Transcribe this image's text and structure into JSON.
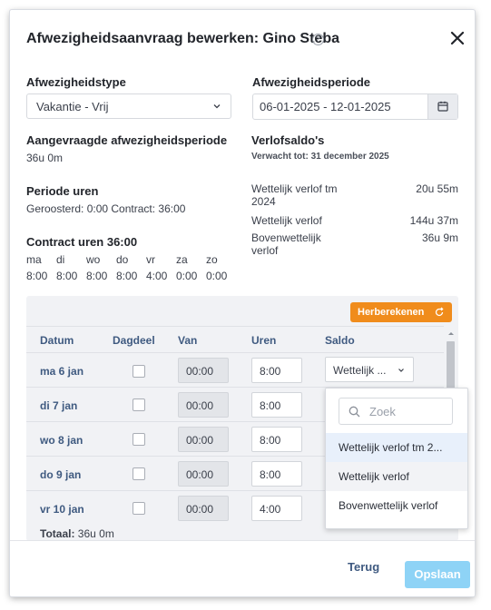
{
  "dialog": {
    "title": "Afwezigheidsaanvraag bewerken: Gino Steba",
    "help_icon": "question-circle-icon",
    "close_icon": "close-icon"
  },
  "type": {
    "label": "Afwezigheidstype",
    "value": "Vakantie - Vrij"
  },
  "period": {
    "label": "Afwezigheidsperiode",
    "value": "06-01-2025 - 12-01-2025",
    "icon": "calendar-icon"
  },
  "requested": {
    "label": "Aangevraagde afwezigheidsperiode",
    "value": "36u 0m"
  },
  "period_hours": {
    "label": "Periode uren",
    "value": "Geroosterd: 0:00 Contract: 36:00"
  },
  "contract": {
    "label": "Contract uren 36:00",
    "days": [
      "ma",
      "di",
      "wo",
      "do",
      "vr",
      "za",
      "zo"
    ],
    "hours": [
      "8:00",
      "8:00",
      "8:00",
      "8:00",
      "4:00",
      "0:00",
      "0:00"
    ]
  },
  "balances": {
    "label": "Verlofsaldo's",
    "expected": "Verwacht tot: 31 december 2025",
    "items": [
      {
        "name_line1": "Wettelijk verlof tm",
        "name_line2": "2024",
        "value": "20u 55m"
      },
      {
        "name_line1": "Wettelijk verlof",
        "name_line2": "",
        "value": "144u 37m"
      },
      {
        "name_line1": "Bovenwettelijk",
        "name_line2": "verlof",
        "value": "36u 9m"
      }
    ]
  },
  "table": {
    "recalc_label": "Herberekenen",
    "headers": {
      "date": "Datum",
      "part": "Dagdeel",
      "from": "Van",
      "hours": "Uren",
      "balance": "Saldo"
    },
    "rows": [
      {
        "date": "ma 6 jan",
        "from": "00:00",
        "hours": "8:00"
      },
      {
        "date": "di 7 jan",
        "from": "00:00",
        "hours": "8:00"
      },
      {
        "date": "wo 8 jan",
        "from": "00:00",
        "hours": "8:00"
      },
      {
        "date": "do 9 jan",
        "from": "00:00",
        "hours": "8:00"
      },
      {
        "date": "vr 10 jan",
        "from": "00:00",
        "hours": "4:00"
      }
    ],
    "saldo_value": "Wettelijk ...",
    "total_label": "Totaal:",
    "total_value": "36u 0m"
  },
  "dropdown": {
    "search_placeholder": "Zoek",
    "options": [
      "Wettelijk verlof tm 2...",
      "Wettelijk verlof",
      "Bovenwettelijk verlof"
    ],
    "highlighted_index": 0
  },
  "footer": {
    "back_label": "Terug",
    "save_label": "Opslaan"
  },
  "colors": {
    "accent_orange": "#f08c1c",
    "save_blue": "#8ed3f6",
    "link_blue": "#3f5a80"
  }
}
